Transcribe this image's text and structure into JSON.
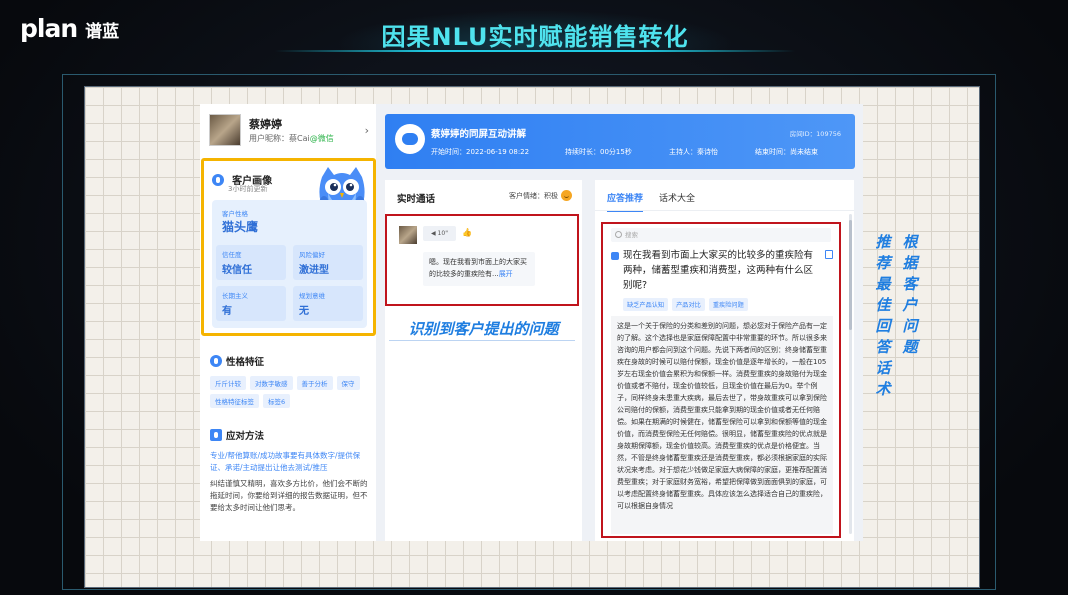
{
  "brand": {
    "logo_text": "plan",
    "name": "谱蓝"
  },
  "slide": {
    "title": "因果NLU实时赋能销售转化"
  },
  "profile": {
    "name": "蔡婷婷",
    "nickname_label": "用户昵称：蔡Cai",
    "nickname_wechat": "@微信"
  },
  "portrait": {
    "title": "客户画像",
    "updated": "3小时前更新",
    "persona_label": "客户性格",
    "persona_value": "猫头鹰",
    "traits": [
      {
        "key": "信任度",
        "value": "较信任"
      },
      {
        "key": "风险偏好",
        "value": "激进型"
      },
      {
        "key": "长期主义",
        "value": "有"
      },
      {
        "key": "规划意维",
        "value": "无"
      }
    ]
  },
  "character": {
    "title": "性格特征",
    "tags": [
      "斤斤计较",
      "对数字敏感",
      "善于分析",
      "保守",
      "性格特征标签",
      "标签6"
    ]
  },
  "method": {
    "title": "应对方法",
    "highlight": "专业/帮他算账/成功故事要有具体数字/提供保证、承诺/主动提出让他去测试/推压",
    "body": "纠结谨慎又精明，喜欢多方比价，他们会不断的拖延时间，你要给到详细的报告数据证明，但不要给太多时间让他们思考。"
  },
  "session": {
    "title": "蔡婷婷的同屏互动讲解",
    "room": "房间ID：109756",
    "start": "开始时间：2022-06-19 08:22",
    "duration": "持续时长：00分15秒",
    "host": "主持人：秦诗怡",
    "end": "结束时间：尚未结束"
  },
  "call": {
    "title": "实时通话",
    "mood_label": "客户情绪：积极",
    "voice_len": "◀ 10\"",
    "message": "嗯。现在我看到市面上的大家买的比较多的重疾险有...",
    "expand": "展开",
    "caption": "识别到客户提出的问题"
  },
  "recommend": {
    "tab_active": "应答推荐",
    "tab_other": "话术大全",
    "search_placeholder": "搜索",
    "question": "现在我看到市面上大家买的比较多的重疾险有两种，储蓄型重疾和消费型，这两种有什么区别呢?",
    "tags": [
      "缺乏产品认知",
      "产品对比",
      "重疾险问题"
    ],
    "answer": "这是一个关于保险的分类和差别的问题，想必您对于保险产品有一定的了解。这个选择也是家庭保障配置中非常重要的环节。所以很多来咨询的用户都会问到这个问题。先说下两者间的区别：终身储蓄型重疾在身故的时候可以赔付保额，现金价值是逐年增长的，一般在105岁左右现金价值会累积为和保额一样。消费型重疾的身故赔付为现金价值或者不赔付，现金价值较低，且现金价值在最后为0。举个例子，同样终身未患重大疾病，最后去世了，带身故重疾可以拿到保险公司赔付的保额，消费型重疾只能拿到期的现金价值或者无任何赔偿。如果在期满的时候健在，储蓄型保险可以拿到和保额等值的现金价值，而消费型保险无任何赔偿。很明显，储蓄型重疾险的优点就是身故期保障额，现金价值较高。消费型重疾的优点是价格便宜。当然，不管是终身储蓄型重疾还是消费型重疾，都必须根据家庭的实际状况来考虑。对于想花少钱做足家庭大病保障的家庭，更推荐配置消费型重疾；对于家庭财务宽裕，希望把保障做到面面俱到的家庭，可以考虑配置终身储蓄型重疾。具体应该怎么选择适合自己的重疾险，可以根据自身情况",
    "caption": "根据客户问题推荐最佳回答话术"
  },
  "colors": {
    "accent": "#3d86f5",
    "highlight_box": "#f5b400",
    "alert_box": "#c0141c",
    "title": "#4fe3ee"
  }
}
